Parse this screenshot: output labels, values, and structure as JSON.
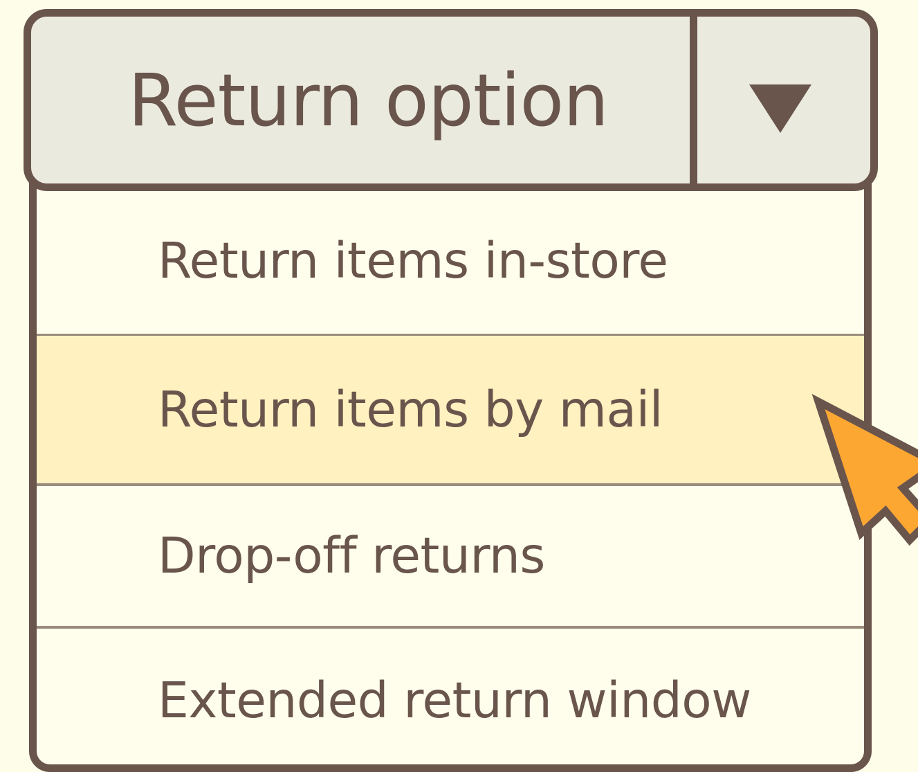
{
  "dropdown": {
    "label": "Return option",
    "caret_icon": "triangle-down-icon",
    "options": [
      {
        "label": "Return items in-store",
        "highlighted": false
      },
      {
        "label": "Return items by mail",
        "highlighted": true
      },
      {
        "label": "Drop-off returns",
        "highlighted": false
      },
      {
        "label": "Extended return window",
        "highlighted": false
      }
    ]
  },
  "cursor": {
    "icon": "mouse-pointer-icon"
  },
  "colors": {
    "background": "#fefde9",
    "header_fill": "#ebeadf",
    "border": "#69554c",
    "text": "#69554c",
    "list_fill": "#fffeed",
    "highlight_fill": "#fff1c0",
    "divider": "#9a8c7c",
    "cursor_fill": "#fda733"
  }
}
